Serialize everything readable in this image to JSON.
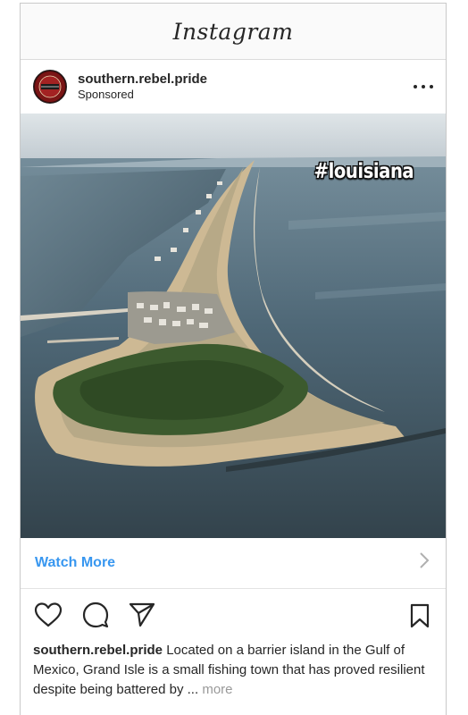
{
  "app": {
    "title": "Instagram"
  },
  "post": {
    "username": "southern.rebel.pride",
    "label": "Sponsored",
    "image_overlay": "#louisiana",
    "cta": "Watch More",
    "caption": {
      "username": "southern.rebel.pride",
      "text": "Located on a barrier island in the Gulf of Mexico, Grand Isle is a small fishing town that has proved resilient despite being battered by",
      "ellipsis": "...",
      "more": "more"
    }
  },
  "icons": {
    "options": "more-options-icon",
    "like": "heart-icon",
    "comment": "comment-icon",
    "share": "send-icon",
    "save": "bookmark-icon",
    "cta": "chevron-right-icon"
  },
  "colors": {
    "link": "#3897f0",
    "text": "#262626",
    "muted": "#999999"
  }
}
